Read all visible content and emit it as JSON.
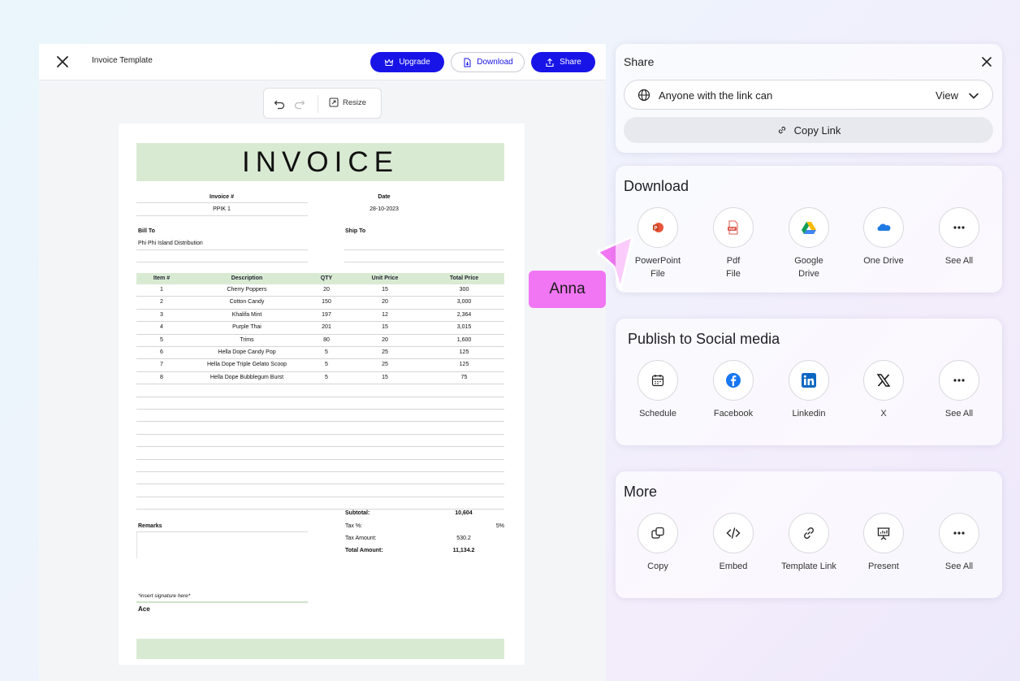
{
  "editor": {
    "title": "Invoice Template",
    "upgrade_label": "Upgrade",
    "download_label": "Download",
    "share_label": "Share",
    "resize_label": "Resize"
  },
  "invoice": {
    "heading": "INVOICE",
    "invoice_no_label": "Invoice #",
    "invoice_no": "PPIK 1",
    "date_label": "Date",
    "date": "28-10-2023",
    "bill_to_label": "Bill To",
    "bill_to": "Phi Phi Island Distribution",
    "ship_to_label": "Ship To",
    "columns": [
      "Item #",
      "Description",
      "QTY",
      "Unit Price",
      "Total Price"
    ],
    "rows": [
      [
        "1",
        "Cherry Poppers",
        "20",
        "15",
        "300"
      ],
      [
        "2",
        "Cotton Candy",
        "150",
        "20",
        "3,000"
      ],
      [
        "3",
        "Khalifa Mint",
        "197",
        "12",
        "2,364"
      ],
      [
        "4",
        "Purple Thai",
        "201",
        "15",
        "3,015"
      ],
      [
        "5",
        "Trims",
        "80",
        "20",
        "1,600"
      ],
      [
        "6",
        "Hella Dope Candy Pop",
        "5",
        "25",
        "125"
      ],
      [
        "7",
        "Hella Dope Triple Gelato Scoop",
        "5",
        "25",
        "125"
      ],
      [
        "8",
        "Hella Dope Bubblegum Burst",
        "5",
        "15",
        "75"
      ]
    ],
    "remarks_label": "Remarks",
    "subtotal_label": "Subtotal:",
    "subtotal": "10,604",
    "tax_pct_label": "Tax %:",
    "tax_pct": "5%",
    "tax_amount_label": "Tax Amount:",
    "tax_amount": "530.2",
    "total_label": "Total Amount:",
    "total": "11,134.2",
    "signature_hint": "*insert signature here*",
    "signer": "Ace"
  },
  "annotation": {
    "name": "Anna",
    "color": "#f176f3"
  },
  "share": {
    "title": "Share",
    "permission_text": "Anyone with the link can",
    "permission_value": "View",
    "copy_link_label": "Copy Link"
  },
  "download": {
    "title": "Download",
    "options": [
      {
        "label": "PowerPoint\nFile",
        "icon": "powerpoint-icon"
      },
      {
        "label": "Pdf\nFile",
        "icon": "pdf-icon"
      },
      {
        "label": "Google\nDrive",
        "icon": "google-drive-icon"
      },
      {
        "label": "One Drive",
        "icon": "onedrive-icon"
      },
      {
        "label": "See All",
        "icon": "more-icon"
      }
    ]
  },
  "social": {
    "title": "Publish to Social media",
    "options": [
      {
        "label": "Schedule",
        "icon": "calendar-icon"
      },
      {
        "label": "Facebook",
        "icon": "facebook-icon"
      },
      {
        "label": "Linkedin",
        "icon": "linkedin-icon"
      },
      {
        "label": "X",
        "icon": "x-icon"
      },
      {
        "label": "See All",
        "icon": "more-icon"
      }
    ]
  },
  "more": {
    "title": "More",
    "options": [
      {
        "label": "Copy",
        "icon": "copy-icon"
      },
      {
        "label": "Embed",
        "icon": "code-icon"
      },
      {
        "label": "Template Link",
        "icon": "link-icon"
      },
      {
        "label": "Present",
        "icon": "presentation-icon"
      },
      {
        "label": "See All",
        "icon": "more-icon"
      }
    ]
  },
  "colors": {
    "brand": "#1814e8",
    "invoice_accent": "#d9ead3"
  }
}
